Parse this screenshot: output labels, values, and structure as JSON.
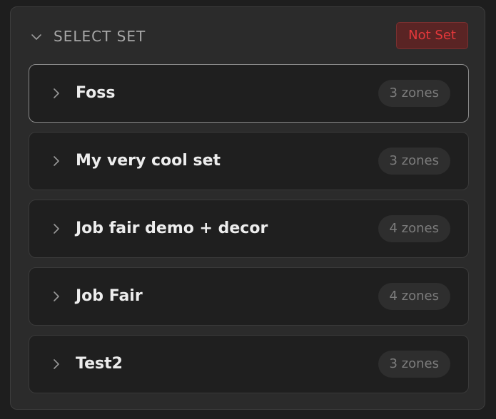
{
  "header": {
    "title": "SELECT SET",
    "status": "Not Set",
    "status_color": "#e5383b"
  },
  "sets": [
    {
      "name": "Foss",
      "zones": "3 zones",
      "active": true
    },
    {
      "name": "My very cool set",
      "zones": "3 zones",
      "active": false
    },
    {
      "name": "Job fair demo + decor",
      "zones": "4 zones",
      "active": false
    },
    {
      "name": "Job Fair",
      "zones": "4 zones",
      "active": false
    },
    {
      "name": "Test2",
      "zones": "3 zones",
      "active": false
    }
  ],
  "icons": {
    "collapse": "chevron-down-icon",
    "expand": "chevron-right-icon"
  }
}
